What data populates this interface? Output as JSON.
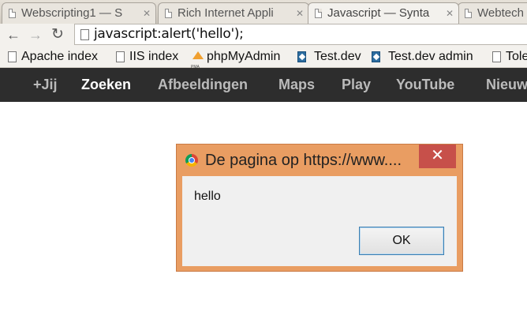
{
  "tabs": [
    {
      "label": "Webscripting1 — S",
      "active": false
    },
    {
      "label": "Rich Internet Appli",
      "active": false
    },
    {
      "label": "Javascript — Synta",
      "active": true
    },
    {
      "label": "Webtech",
      "active": false
    }
  ],
  "toolbar": {
    "back_icon": "back-arrow-icon",
    "forward_icon": "forward-arrow-icon",
    "reload_icon": "reload-icon",
    "url": "javascript:alert('hello');"
  },
  "bookmarks": [
    {
      "label": "Apache index",
      "icon": "page-icon"
    },
    {
      "label": "IIS index",
      "icon": "page-icon"
    },
    {
      "label": "phpMyAdmin",
      "icon": "phpmyadmin-icon"
    },
    {
      "label": "Test.dev",
      "icon": "testdev-icon"
    },
    {
      "label": "Test.dev admin",
      "icon": "testdev-icon"
    },
    {
      "label": "Tole",
      "icon": "page-icon"
    }
  ],
  "google_bar": {
    "items": [
      "+Jij",
      "Zoeken",
      "Afbeeldingen",
      "Maps",
      "Play",
      "YouTube",
      "Nieuws"
    ],
    "selected": "Zoeken"
  },
  "dialog": {
    "title": "De pagina op https://www....",
    "close_symbol": "✕",
    "message": "hello",
    "ok_label": "OK"
  },
  "colors": {
    "dialog_frame": "#e99d62",
    "close_button": "#c7504a",
    "google_bar": "#2d2d2d"
  }
}
